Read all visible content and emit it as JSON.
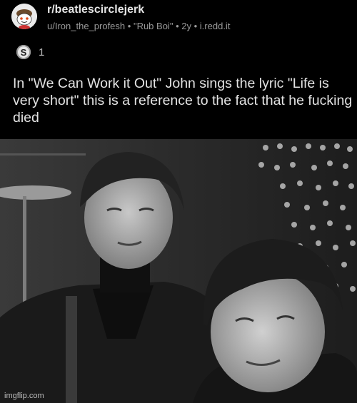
{
  "post": {
    "subreddit": "r/beatlescirclejerk",
    "author": "u/Iron_the_profesh",
    "flair": "\"Rub Boi\"",
    "age": "2y",
    "domain": "i.redd.it",
    "separator": "•",
    "award_count": "1",
    "award_icon_letter": "S",
    "title": "In \"We Can Work it Out\" John sings the lyric \"Life is very short\" this is a reference to the fact that he fucking died"
  },
  "image": {
    "watermark": "imgflip.com"
  },
  "icons": {
    "avatar": "reddit-snoo-avatar-icon",
    "award": "silver-award-icon"
  }
}
